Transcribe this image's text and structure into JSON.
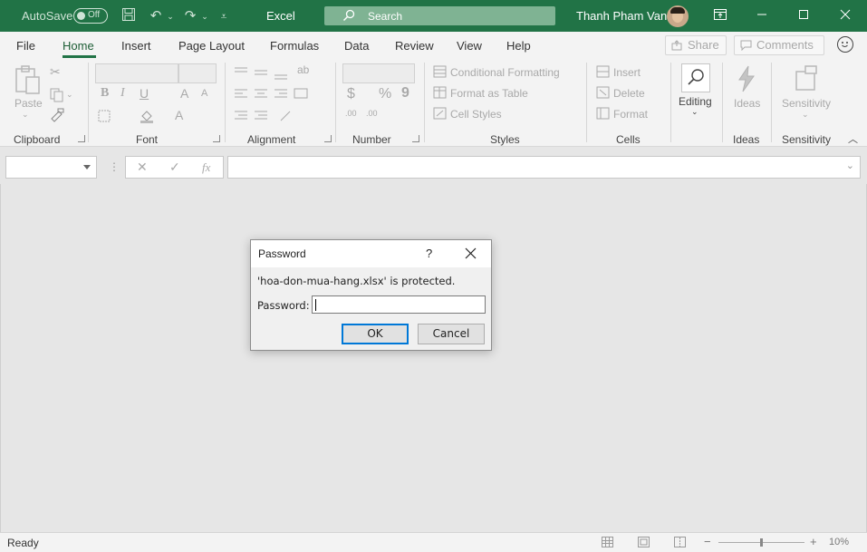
{
  "titlebar": {
    "autosave_label": "AutoSave",
    "autosave_state": "Off",
    "app_name": "Excel",
    "search_placeholder": "Search",
    "user_name": "Thanh Pham Van",
    "accent_color": "#217346"
  },
  "menu": {
    "tabs": [
      "File",
      "Home",
      "Insert",
      "Page Layout",
      "Formulas",
      "Data",
      "Review",
      "View",
      "Help"
    ],
    "active_tab": "Home",
    "share_label": "Share",
    "comments_label": "Comments"
  },
  "ribbon": {
    "clipboard": {
      "paste_label": "Paste",
      "group_label": "Clipboard"
    },
    "font": {
      "group_label": "Font",
      "bold": "B",
      "italic": "I",
      "underline": "U",
      "grow": "A",
      "shrink": "A",
      "font_color": "A"
    },
    "alignment": {
      "group_label": "Alignment"
    },
    "number": {
      "group_label": "Number",
      "currency": "$",
      "percent": "%",
      "comma": "9",
      "inc_decimal": ".00",
      "dec_decimal": ".00"
    },
    "styles": {
      "group_label": "Styles",
      "conditional_formatting": "Conditional Formatting",
      "format_as_table": "Format as Table",
      "cell_styles": "Cell Styles"
    },
    "cells": {
      "group_label": "Cells",
      "insert": "Insert",
      "delete": "Delete",
      "format": "Format"
    },
    "editing": {
      "label": "Editing"
    },
    "ideas": {
      "label": "Ideas",
      "group_label": "Ideas"
    },
    "sensitivity": {
      "label": "Sensitivity",
      "group_label": "Sensitivity"
    }
  },
  "formula_bar": {
    "fx": "fx",
    "value": ""
  },
  "dialog": {
    "title": "Password",
    "help": "?",
    "message": "'hoa-don-mua-hang.xlsx' is protected.",
    "password_label": "Password:",
    "password_value": "",
    "ok_label": "OK",
    "cancel_label": "Cancel"
  },
  "statusbar": {
    "status": "Ready",
    "zoom": "10%"
  }
}
